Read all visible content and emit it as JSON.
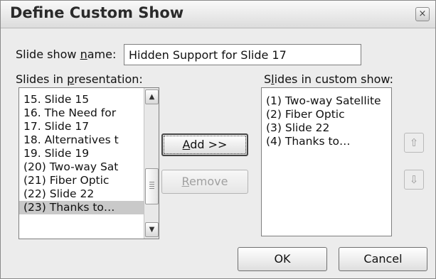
{
  "window": {
    "title": "Define Custom Show",
    "close_glyph": "×"
  },
  "show_name": {
    "label_before": "Slide show ",
    "label_u": "n",
    "label_after": "ame:",
    "value": "Hidden Support for Slide 17"
  },
  "presentation_list": {
    "label_before": "Slides in ",
    "label_u": "p",
    "label_after": "resentation:",
    "items": [
      "15. Slide 15",
      "16. The Need for",
      "17. Slide 17",
      "18. Alternatives t",
      "19. Slide 19",
      "(20) Two-way Sat",
      "(21) Fiber Optic",
      "(22) Slide 22",
      "(23) Thanks to…"
    ],
    "selected_index": 8,
    "scroll_up_glyph": "▲",
    "scroll_down_glyph": "▼"
  },
  "buttons": {
    "add_u": "A",
    "add_rest": "dd >>",
    "remove_u": "R",
    "remove_rest": "emove",
    "ok": "OK",
    "cancel": "Cancel",
    "move_up_glyph": "⇧",
    "move_down_glyph": "⇩"
  },
  "custom_list": {
    "label_before": "S",
    "label_u": "l",
    "label_after": "ides in custom show:",
    "items": [
      "(1) Two-way Satellite",
      "(2) Fiber Optic",
      "(3) Slide 22",
      "(4) Thanks to…"
    ]
  }
}
